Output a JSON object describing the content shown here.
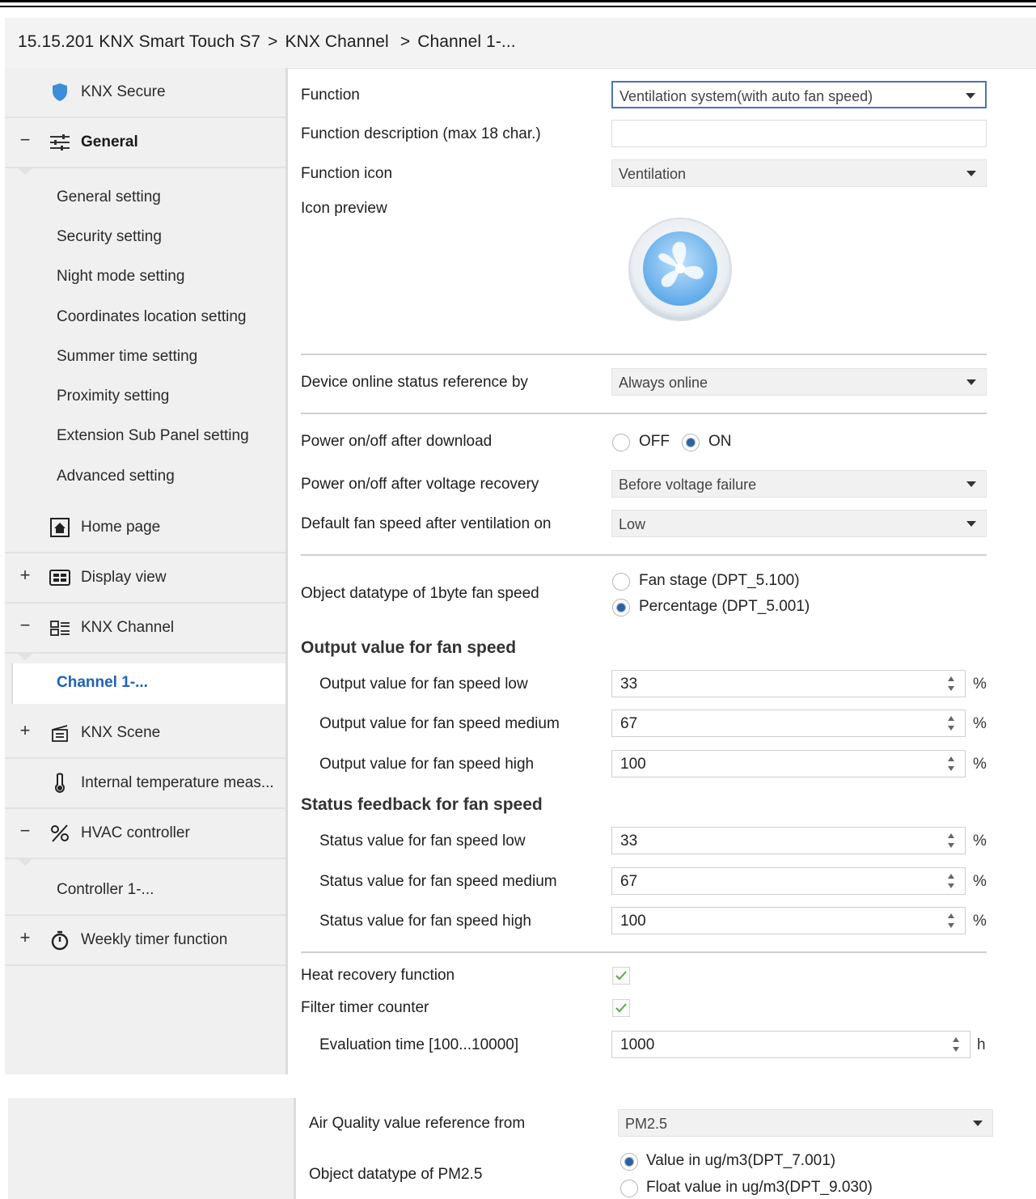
{
  "breadcrumb": {
    "device": "15.15.201 KNX Smart Touch S7",
    "sep1": ">",
    "channel": "KNX Channel",
    "sep2": ">",
    "current": "Channel 1-..."
  },
  "sidebar": {
    "knx_secure": "KNX Secure",
    "general": {
      "toggle": "−",
      "label": "General"
    },
    "general_subitems": [
      "General setting",
      "Security setting",
      "Night mode setting",
      "Coordinates location setting",
      "Summer time setting",
      "Proximity setting",
      "Extension Sub Panel setting",
      "Advanced setting"
    ],
    "home_page": "Home page",
    "display_view": {
      "toggle": "+",
      "label": "Display view"
    },
    "knx_channel": {
      "toggle": "−",
      "label": "KNX Channel"
    },
    "channel_selected": "Channel 1-...",
    "knx_scene": {
      "toggle": "+",
      "label": "KNX Scene"
    },
    "internal_temp": "Internal temperature meas...",
    "hvac": {
      "toggle": "−",
      "label": "HVAC controller"
    },
    "controller": "Controller 1-...",
    "weekly_timer": {
      "toggle": "+",
      "label": "Weekly timer function"
    }
  },
  "main": {
    "function": {
      "label": "Function",
      "value": "Ventilation system(with auto fan speed)"
    },
    "function_description": {
      "label": "Function description (max 18 char.)",
      "value": ""
    },
    "function_icon": {
      "label": "Function icon",
      "value": "Ventilation"
    },
    "icon_preview": {
      "label": "Icon preview",
      "icon": "fan-icon"
    },
    "online_status": {
      "label": "Device online status reference by",
      "value": "Always online"
    },
    "power_after_download": {
      "label": "Power on/off after download",
      "options": [
        "OFF",
        "ON"
      ],
      "selected": "ON"
    },
    "power_after_recovery": {
      "label": "Power on/off after voltage recovery",
      "value": "Before voltage failure"
    },
    "default_fan_speed": {
      "label": "Default fan speed after ventilation on",
      "value": "Low"
    },
    "object_datatype": {
      "label": "Object datatype of 1byte fan speed",
      "options": [
        "Fan stage (DPT_5.100)",
        "Percentage (DPT_5.001)"
      ],
      "selected": "Percentage (DPT_5.001)"
    },
    "output_section": "Output value for fan speed",
    "output_low": {
      "label": "Output value for fan speed low",
      "value": "33",
      "unit": "%"
    },
    "output_medium": {
      "label": "Output value for fan speed medium",
      "value": "67",
      "unit": "%"
    },
    "output_high": {
      "label": "Output value for fan speed high",
      "value": "100",
      "unit": "%"
    },
    "status_section": "Status feedback for fan speed",
    "status_low": {
      "label": "Status value for fan speed low",
      "value": "33",
      "unit": "%"
    },
    "status_medium": {
      "label": "Status value for fan speed medium",
      "value": "67",
      "unit": "%"
    },
    "status_high": {
      "label": "Status value for fan speed high",
      "value": "100",
      "unit": "%"
    },
    "heat_recovery": {
      "label": "Heat recovery function",
      "checked": true
    },
    "filter_timer": {
      "label": "Filter timer counter",
      "checked": true
    },
    "evaluation_time": {
      "label": "Evaluation time [100...10000]",
      "value": "1000",
      "unit": "h"
    }
  },
  "lower": {
    "air_quality": {
      "label": "Air Quality value reference from",
      "value": "PM2.5"
    },
    "pm25_datatype": {
      "label": "Object datatype of PM2.5",
      "options": [
        "Value in ug/m3(DPT_7.001)",
        "Float value in ug/m3(DPT_9.030)"
      ],
      "selected": "Value in ug/m3(DPT_7.001)"
    }
  },
  "colors": {
    "accent": "#1c62b9",
    "selected_border": "#4a74b8",
    "check": "#5aa84a"
  }
}
